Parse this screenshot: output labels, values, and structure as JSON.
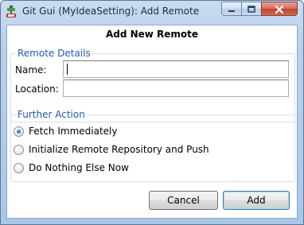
{
  "window": {
    "title": "Git Gui (MyIdeaSetting): Add Remote",
    "icons": {
      "app": "git-gui-icon",
      "minimize": "minimize-icon",
      "maximize": "maximize-icon",
      "close": "close-icon"
    },
    "accent": "#1e5bb8"
  },
  "dialog": {
    "title": "Add New Remote",
    "remote_details": {
      "legend": "Remote Details",
      "name_label": "Name:",
      "name_value": "",
      "location_label": "Location:",
      "location_value": ""
    },
    "further_action": {
      "legend": "Further Action",
      "options": [
        {
          "label": "Fetch Immediately",
          "selected": true
        },
        {
          "label": "Initialize Remote Repository and Push",
          "selected": false
        },
        {
          "label": "Do Nothing Else Now",
          "selected": false
        }
      ]
    },
    "buttons": {
      "cancel": "Cancel",
      "add": "Add"
    }
  }
}
